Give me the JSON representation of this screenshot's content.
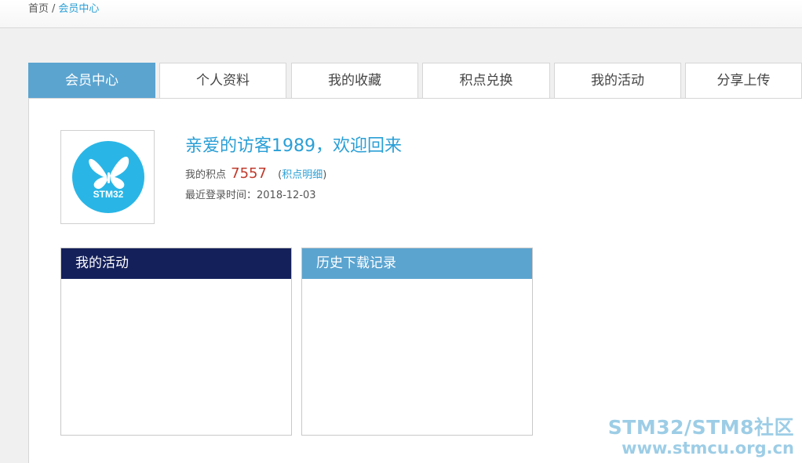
{
  "breadcrumb": {
    "home": "首页",
    "separator": "/",
    "current": "会员中心"
  },
  "tabs": [
    {
      "label": "会员中心",
      "active": true
    },
    {
      "label": "个人资料",
      "active": false
    },
    {
      "label": "我的收藏",
      "active": false
    },
    {
      "label": "积点兑换",
      "active": false
    },
    {
      "label": "我的活动",
      "active": false
    },
    {
      "label": "分享上传",
      "active": false
    }
  ],
  "profile": {
    "avatar_icon": "butterfly-icon",
    "avatar_text": "STM32",
    "welcome": "亲爱的访客1989，欢迎回来",
    "points_label": "我的积点",
    "points_value": "7557",
    "points_link_open": "(",
    "points_link": "积点明细",
    "points_link_close": ")",
    "last_login": "最近登录时间：2018-12-03"
  },
  "cards": {
    "activity_title": "我的活动",
    "downloads_title": "历史下载记录"
  },
  "watermark": {
    "line1": "STM32/STM8社区",
    "line2": "www.stmcu.org.cn"
  },
  "colors": {
    "accent": "#5ba4d0",
    "link": "#2a9fd6",
    "dark_header": "#14205a",
    "points": "#c0392b",
    "avatar_bg": "#29b6e6"
  }
}
